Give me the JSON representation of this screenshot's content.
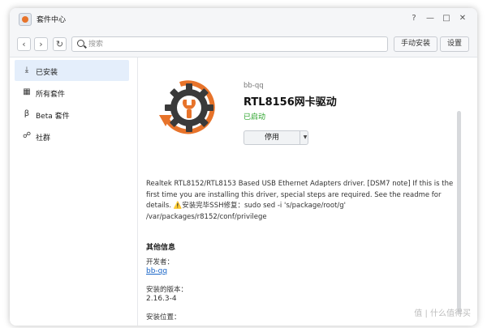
{
  "window": {
    "title": "套件中心",
    "controls": {
      "help": "?",
      "minimize": "—",
      "maximize": "□",
      "close": "✕"
    }
  },
  "toolbar": {
    "back": "‹",
    "forward": "›",
    "refresh": "↻",
    "search_placeholder": "搜索",
    "manual_install_label": "手动安装",
    "settings_label": "设置"
  },
  "sidebar": {
    "items": [
      {
        "label": "已安装",
        "icon": "download-icon",
        "glyph": "⤓",
        "active": true
      },
      {
        "label": "所有套件",
        "icon": "grid-icon",
        "glyph": "▦",
        "active": false
      },
      {
        "label": "Beta 套件",
        "icon": "beta-icon",
        "glyph": "β",
        "active": false
      },
      {
        "label": "社群",
        "icon": "community-icon",
        "glyph": "☍",
        "active": false
      }
    ]
  },
  "package": {
    "developer_top": "bb-qq",
    "name": "RTL8156网卡驱动",
    "status": "已启动",
    "action_label": "停用",
    "description": "Realtek RTL8152/RTL8153 Based USB Ethernet Adapters driver. [DSM7 note] If this is the first time you are installing this driver, special steps are required. See the readme for details. ⚠️安装完毕SSH修复：sudo sed -i 's/package/root/g' /var/packages/r8152/conf/privilege"
  },
  "other_info": {
    "title": "其他信息",
    "developer_label": "开发者：",
    "developer_value": "bb-qq",
    "version_label": "安装的版本：",
    "version_value": "2.16.3-4",
    "location_label": "安装位置："
  },
  "colors": {
    "accent_blue": "#1a66c8",
    "status_green": "#29a329",
    "icon_orange": "#e7732a",
    "icon_dark": "#3a3a3a",
    "sidebar_active": "#e4eefb"
  },
  "watermark": "值 | 什么值得买"
}
